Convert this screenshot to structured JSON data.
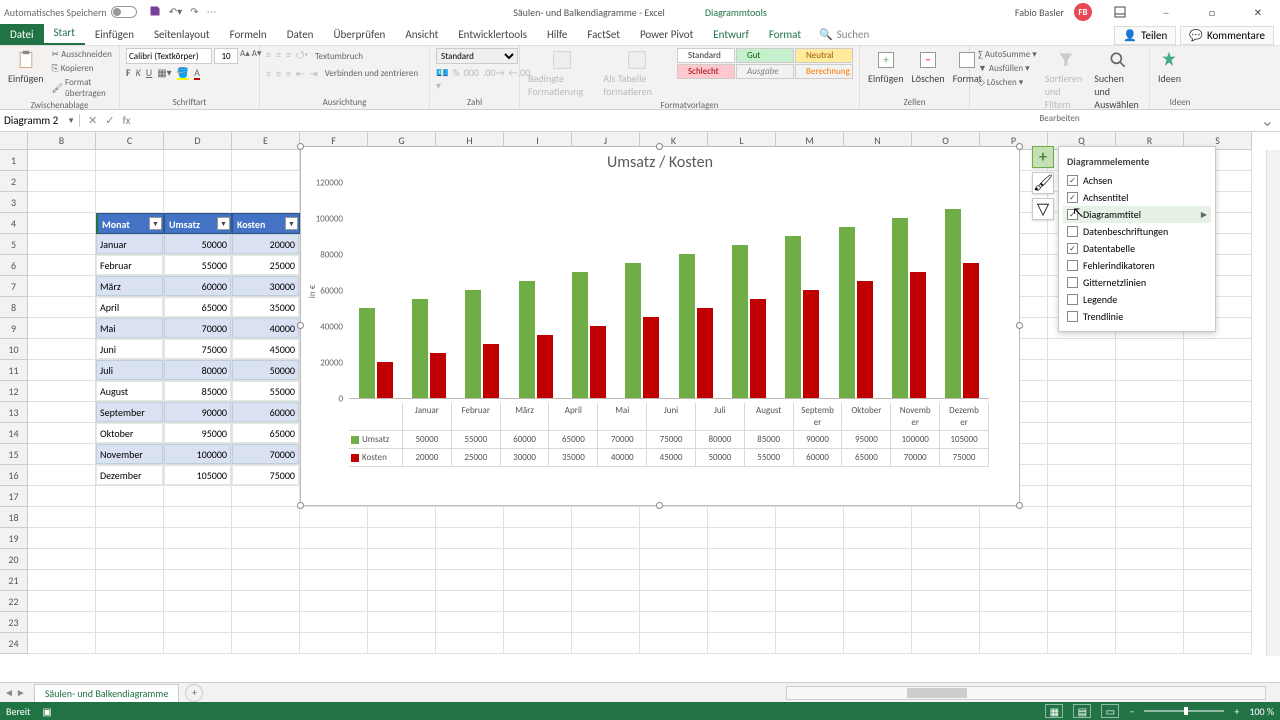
{
  "titlebar": {
    "autosave": "Automatisches Speichern",
    "doc_title": "Säulen- und Balkendiagramme - Excel",
    "tool_tab": "Diagrammtools",
    "user": "Fabio Basler",
    "user_initials": "FB"
  },
  "ribbon_tabs": {
    "file": "Datei",
    "start": "Start",
    "einfugen": "Einfügen",
    "seitenlayout": "Seitenlayout",
    "formeln": "Formeln",
    "daten": "Daten",
    "uberprufen": "Überprüfen",
    "ansicht": "Ansicht",
    "entwickler": "Entwicklertools",
    "hilfe": "Hilfe",
    "factset": "FactSet",
    "powerpivot": "Power Pivot",
    "entwurf": "Entwurf",
    "format": "Format",
    "suchen": "Suchen",
    "teilen": "Teilen",
    "kommentare": "Kommentare"
  },
  "ribbon": {
    "clipboard": {
      "paste": "Einfügen",
      "cut": "Ausschneiden",
      "copy": "Kopieren",
      "format": "Format übertragen",
      "label": "Zwischenablage"
    },
    "font": {
      "name": "Calibri (Textkörper)",
      "size": "10",
      "label": "Schriftart"
    },
    "align": {
      "wrap": "Textumbruch",
      "merge": "Verbinden und zentrieren",
      "label": "Ausrichtung"
    },
    "number": {
      "fmt": "Standard",
      "label": "Zahl"
    },
    "styles": {
      "cond": "Bedingte Formatierung",
      "astable": "Als Tabelle formatieren",
      "standard": "Standard",
      "gut": "Gut",
      "schlecht": "Schlecht",
      "ausgabe": "Ausgabe",
      "berechnung": "Berechnung",
      "label": "Formatvorlagen"
    },
    "cells": {
      "insert": "Einfügen",
      "delete": "Löschen",
      "format": "Format",
      "label": "Zellen"
    },
    "editing": {
      "sum": "AutoSumme",
      "fill": "Ausfüllen",
      "clear": "Löschen",
      "sort": "Sortieren und Filtern",
      "find": "Suchen und Auswählen",
      "label": "Bearbeiten"
    },
    "ideas": {
      "btn": "Ideen",
      "label": "Ideen"
    }
  },
  "namebox": "Diagramm 2",
  "fx_placeholder": "fx",
  "columns": [
    "B",
    "C",
    "D",
    "E",
    "F",
    "G",
    "H",
    "I",
    "J",
    "K",
    "L",
    "M",
    "N",
    "O",
    "P",
    "Q",
    "R",
    "S"
  ],
  "table": {
    "headers": [
      "Monat",
      "Umsatz",
      "Kosten"
    ],
    "rows": [
      {
        "m": "Januar",
        "u": "50000",
        "k": "20000"
      },
      {
        "m": "Februar",
        "u": "55000",
        "k": "25000"
      },
      {
        "m": "März",
        "u": "60000",
        "k": "30000"
      },
      {
        "m": "April",
        "u": "65000",
        "k": "35000"
      },
      {
        "m": "Mai",
        "u": "70000",
        "k": "40000"
      },
      {
        "m": "Juni",
        "u": "75000",
        "k": "45000"
      },
      {
        "m": "Juli",
        "u": "80000",
        "k": "50000"
      },
      {
        "m": "August",
        "u": "85000",
        "k": "55000"
      },
      {
        "m": "September",
        "u": "90000",
        "k": "60000"
      },
      {
        "m": "Oktober",
        "u": "95000",
        "k": "65000"
      },
      {
        "m": "November",
        "u": "100000",
        "k": "70000"
      },
      {
        "m": "Dezember",
        "u": "105000",
        "k": "75000"
      }
    ]
  },
  "chart_data": {
    "type": "bar",
    "title": "Umsatz / Kosten",
    "ylabel": "in €",
    "yticks": [
      "0",
      "20000",
      "40000",
      "60000",
      "80000",
      "100000",
      "120000"
    ],
    "ylim": [
      0,
      120000
    ],
    "categories": [
      "Januar",
      "Februar",
      "März",
      "April",
      "Mai",
      "Juni",
      "Juli",
      "August",
      "September",
      "Oktober",
      "November",
      "Dezember"
    ],
    "cat_display": [
      "Januar",
      "Februar",
      "März",
      "April",
      "Mai",
      "Juni",
      "Juli",
      "August",
      "Septemb er",
      "Oktober",
      "Novemb er",
      "Dezemb er"
    ],
    "series": [
      {
        "name": "Umsatz",
        "values": [
          50000,
          55000,
          60000,
          65000,
          70000,
          75000,
          80000,
          85000,
          90000,
          95000,
          100000,
          105000
        ],
        "color": "#70ad47"
      },
      {
        "name": "Kosten",
        "values": [
          20000,
          25000,
          30000,
          35000,
          40000,
          45000,
          50000,
          55000,
          60000,
          65000,
          70000,
          75000
        ],
        "color": "#c00000"
      }
    ]
  },
  "chart_elements": {
    "title": "Diagrammelemente",
    "items": [
      {
        "label": "Achsen",
        "checked": true
      },
      {
        "label": "Achsentitel",
        "checked": true
      },
      {
        "label": "Diagrammtitel",
        "checked": true,
        "hover": true,
        "arrow": true
      },
      {
        "label": "Datenbeschriftungen",
        "checked": false
      },
      {
        "label": "Datentabelle",
        "checked": true
      },
      {
        "label": "Fehlerindikatoren",
        "checked": false
      },
      {
        "label": "Gitternetzlinien",
        "checked": false
      },
      {
        "label": "Legende",
        "checked": false
      },
      {
        "label": "Trendlinie",
        "checked": false
      }
    ]
  },
  "sheet_tab": "Säulen- und Balkendiagramme",
  "status": {
    "ready": "Bereit",
    "zoom": "100 %"
  }
}
